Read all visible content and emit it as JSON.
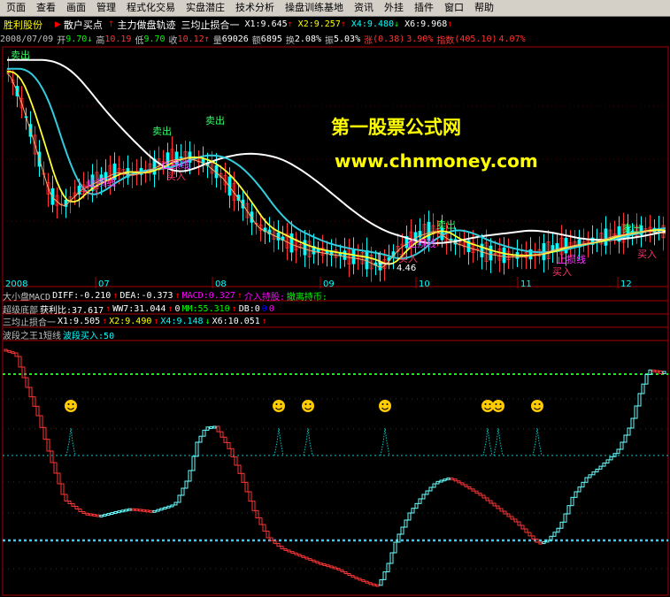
{
  "menu": {
    "items": [
      "页面",
      "查看",
      "画面",
      "管理",
      "程式化交易",
      "实盘潜庄",
      "技术分析",
      "操盘训练基地",
      "资讯",
      "外挂",
      "插件",
      "窗口",
      "帮助"
    ]
  },
  "header": {
    "stock_name": "胜利股份",
    "tabs": [
      {
        "label": "散户买点",
        "marker": "▶",
        "color": "#ff0000"
      },
      {
        "label": "主力做盘轨迹",
        "marker": "↑",
        "color": "#ff0000"
      },
      {
        "label": "三均止损合一",
        "marker": "",
        "color": ""
      }
    ],
    "ma_values": [
      {
        "label": "X1:9.645",
        "arrow": "↑",
        "color": "#ffffff",
        "arrow_color": "#ff0000"
      },
      {
        "label": "X2:9.257",
        "arrow": "↑",
        "color": "#ffff00",
        "arrow_color": "#ff0000"
      },
      {
        "label": "X4:9.480",
        "arrow": "↓",
        "color": "#00ffff",
        "arrow_color": "#00ff00"
      },
      {
        "label": "X6:9.968",
        "arrow": "↑",
        "color": "#ffffff",
        "arrow_color": "#ff0000"
      }
    ]
  },
  "quote": {
    "date": "2008/07/09",
    "open_label": "开",
    "open": "9.70",
    "open_arrow": "↓",
    "high_label": "高",
    "high": "10.19",
    "low_label": "低",
    "low": "9.70",
    "close_label": "收",
    "close": "10.12",
    "close_arrow": "↑",
    "volume_label": "量",
    "volume": "69026",
    "amount_label": "额",
    "amount": "6895",
    "turnover_label": "换",
    "turnover": "2.08%",
    "amplitude_label": "振",
    "amplitude": "5.03%",
    "change_label": "涨",
    "change": "(0.38)",
    "change_pct": "3.90%",
    "index_label": "指数",
    "index": "(405.10)",
    "index_pct": "4.07%"
  },
  "watermark": {
    "title": "第一股票公式网",
    "url": "www.chnmoney.com"
  },
  "price_chart": {
    "signals": [
      "卖出",
      "卖出",
      "卖出",
      "卖出",
      "卖出"
    ],
    "stoploss": "止损线",
    "buy": "买入",
    "low_price_label": "4.46",
    "x_labels": [
      "2008",
      "07",
      "08",
      "09",
      "10",
      "11",
      "12"
    ]
  },
  "indicators": {
    "macd_line": [
      {
        "text": "大小盘MACD",
        "color": "#c0c0c0"
      },
      {
        "text": "DIFF:-0.210",
        "color": "#ffffff"
      },
      {
        "text": "↑",
        "color": "#ff0000"
      },
      {
        "text": "DEA:-0.373",
        "color": "#ffffff"
      },
      {
        "text": "↑",
        "color": "#ff0000"
      },
      {
        "text": "MACD:0.327",
        "color": "#ff00ff"
      },
      {
        "text": "↑",
        "color": "#ff0000"
      },
      {
        "text": "介入持股:",
        "color": "#ff00ff"
      },
      {
        "text": "撤离持币:",
        "color": "#00ff00"
      }
    ],
    "bottom_line": [
      {
        "text": "超级底部",
        "color": "#c0c0c0"
      },
      {
        "text": "获利比:37.617",
        "color": "#ffffff"
      },
      {
        "text": "↑",
        "color": "#ff0000"
      },
      {
        "text": "WW7:31.044",
        "color": "#ffffff"
      },
      {
        "text": "↑",
        "color": "#ff0000"
      },
      {
        "text": "0",
        "color": "#ffffff"
      },
      {
        "text": "MM:55.310",
        "color": "#00ff00"
      },
      {
        "text": "↑",
        "color": "#ff0000"
      },
      {
        "text": "DB:0",
        "color": "#ffffff"
      },
      {
        "text": "0",
        "color": "#0000ff"
      },
      {
        "text": "0",
        "color": "#ff00ff"
      }
    ],
    "stop_line": [
      {
        "text": "三均止损合一",
        "color": "#c0c0c0"
      },
      {
        "text": "X1:9.505",
        "color": "#ffffff"
      },
      {
        "text": "↑",
        "color": "#ff0000"
      },
      {
        "text": "X2:9.490",
        "color": "#ffff00"
      },
      {
        "text": "↑",
        "color": "#ff0000"
      },
      {
        "text": "X4:9.148",
        "color": "#00ffff"
      },
      {
        "text": "↓",
        "color": "#00ff00"
      },
      {
        "text": "X6:10.051",
        "color": "#ffffff"
      },
      {
        "text": "↑",
        "color": "#ff0000"
      }
    ],
    "wave_line": [
      {
        "text": "波段之王1短线",
        "color": "#c0c0c0"
      },
      {
        "text": "波段买入:50",
        "color": "#00ffff"
      }
    ]
  },
  "colors": {
    "up": "#ff3333",
    "down": "#00ffff",
    "ma_white": "#ffffff",
    "ma_yellow": "#ffff33",
    "ma_cyan": "#33ccdd",
    "signal_green": "#33ff66",
    "signal_magenta": "#ff33ff",
    "grid_red": "#aa0000",
    "level_green": "#00ff00",
    "level_cyan": "#00cccc",
    "smiley": "#ffcc00"
  }
}
